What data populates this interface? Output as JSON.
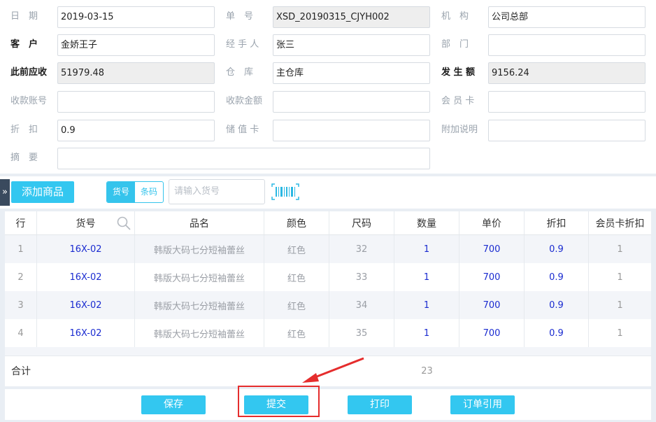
{
  "form": {
    "row1": {
      "date_label": "日　期",
      "date_value": "2019-03-15",
      "order_label": "单　号",
      "order_value": "XSD_20190315_CJYH002",
      "org_label": "机　构",
      "org_value": "公司总部"
    },
    "row2": {
      "customer_label": "客　户",
      "customer_value": "金娇王子",
      "handler_label": "经 手 人",
      "handler_value": "张三",
      "dept_label": "部　门",
      "dept_value": ""
    },
    "row3": {
      "receivable_label": "此前应收",
      "receivable_value": "51979.48",
      "warehouse_label": "仓　库",
      "warehouse_value": "主仓库",
      "amount_label": "发 生 额",
      "amount_value": "9156.24"
    },
    "row4": {
      "account_label": "收款账号",
      "account_value": "",
      "pay_amount_label": "收款金额",
      "pay_amount_value": "",
      "member_label": "会 员 卡",
      "member_value": ""
    },
    "row5": {
      "discount_label": "折　扣",
      "discount_value": "0.9",
      "stored_label": "储 值 卡",
      "stored_value": "",
      "note_label": "附加说明",
      "note_value": ""
    },
    "row6": {
      "summary_label": "摘　要",
      "summary_value": ""
    }
  },
  "toolbar": {
    "side_tab": "»",
    "add_label": "添加商品",
    "toggle_on": "货号",
    "toggle_off": "条码",
    "search_placeholder": "请输入货号",
    "barcode_icon": "barcode-icon"
  },
  "grid": {
    "headers": [
      "行",
      "货号",
      "品名",
      "颜色",
      "尺码",
      "数量",
      "单价",
      "折扣",
      "会员卡折扣"
    ],
    "rows": [
      [
        "1",
        "16X-02",
        "韩版大码七分短袖蕾丝",
        "红色",
        "32",
        "1",
        "700",
        "0.9",
        "1"
      ],
      [
        "2",
        "16X-02",
        "韩版大码七分短袖蕾丝",
        "红色",
        "33",
        "1",
        "700",
        "0.9",
        "1"
      ],
      [
        "3",
        "16X-02",
        "韩版大码七分短袖蕾丝",
        "红色",
        "34",
        "1",
        "700",
        "0.9",
        "1"
      ],
      [
        "4",
        "16X-02",
        "韩版大码七分短袖蕾丝",
        "红色",
        "35",
        "1",
        "700",
        "0.9",
        "1"
      ]
    ]
  },
  "totals": {
    "label": "合计",
    "quantity": "23"
  },
  "footer": {
    "save": "保存",
    "submit": "提交",
    "print": "打印",
    "order_ref": "订单引用"
  },
  "colors": {
    "accent": "#33c7f0",
    "highlight": "#e52d2d",
    "link": "#1a2bd0"
  }
}
